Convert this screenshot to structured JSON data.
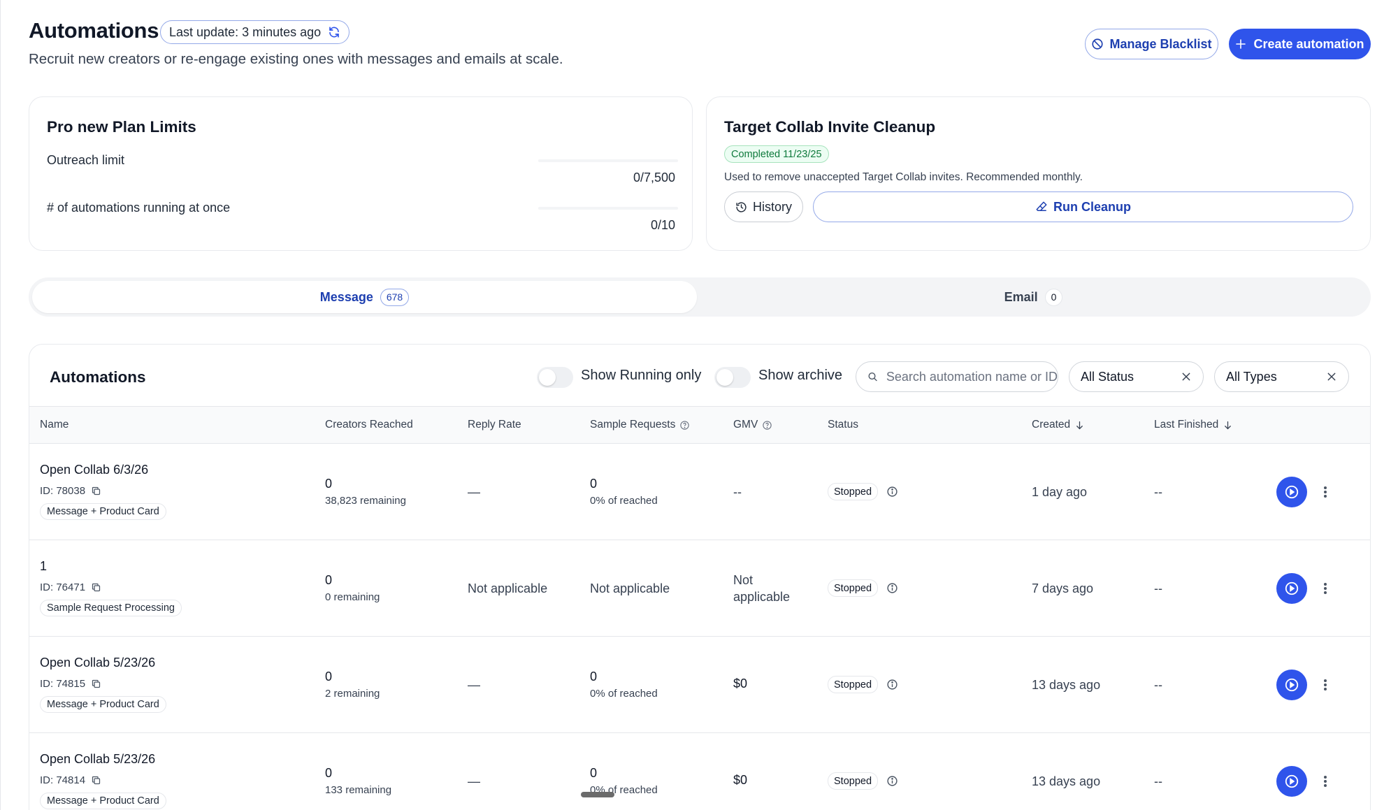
{
  "header": {
    "title": "Automations",
    "last_update": "Last update: 3 minutes ago",
    "subtitle": "Recruit new creators or re-engage existing ones with messages and emails at scale.",
    "manage_blacklist": "Manage Blacklist",
    "create_automation": "Create automation"
  },
  "limits_card": {
    "title": "Pro new Plan Limits",
    "outreach_label": "Outreach limit",
    "outreach_value": "0/7,500",
    "outreach_progress": 0,
    "running_label": "# of automations running at once",
    "running_value": "0/10",
    "running_progress": 0
  },
  "cleanup_card": {
    "title": "Target Collab Invite Cleanup",
    "badge": "Completed 11/23/25",
    "description": "Used to remove unaccepted Target Collab invites. Recommended monthly.",
    "history": "History",
    "run_cleanup": "Run Cleanup"
  },
  "tabs": [
    {
      "label": "Message",
      "count": "678",
      "active": true
    },
    {
      "label": "Email",
      "count": "0",
      "active": false
    }
  ],
  "table_panel": {
    "title": "Automations",
    "show_running": "Show Running only",
    "show_archive": "Show archive",
    "search_placeholder": "Search automation name or ID",
    "status_filter": "All Status",
    "type_filter": "All Types"
  },
  "columns": {
    "name": "Name",
    "creators": "Creators Reached",
    "reply": "Reply Rate",
    "samples": "Sample Requests",
    "gmv": "GMV",
    "status": "Status",
    "created": "Created",
    "last_finished": "Last Finished"
  },
  "rows": [
    {
      "name": "Open Collab 6/3/26",
      "id": "ID: 78038",
      "type": "Message + Product Card",
      "creators": "0",
      "remaining": "38,823 remaining",
      "reply": "—",
      "samples": "0",
      "samples_sub": "0% of reached",
      "gmv": "--",
      "status": "Stopped",
      "created": "1 day ago",
      "last_finished": "--"
    },
    {
      "name": "1",
      "id": "ID: 76471",
      "type": "Sample Request Processing",
      "creators": "0",
      "remaining": "0 remaining",
      "reply": "Not applicable",
      "samples": "Not applicable",
      "samples_sub": "",
      "gmv_line1": "Not",
      "gmv_line2": "applicable",
      "status": "Stopped",
      "created": "7 days ago",
      "last_finished": "--"
    },
    {
      "name": "Open Collab 5/23/26",
      "id": "ID: 74815",
      "type": "Message + Product Card",
      "creators": "0",
      "remaining": "2 remaining",
      "reply": "—",
      "samples": "0",
      "samples_sub": "0% of reached",
      "gmv": "$0",
      "status": "Stopped",
      "created": "13 days ago",
      "last_finished": "--"
    },
    {
      "name": "Open Collab 5/23/26",
      "id": "ID: 74814",
      "type": "Message + Product Card",
      "creators": "0",
      "remaining": "133 remaining",
      "reply": "—",
      "samples": "0",
      "samples_sub": "0% of reached",
      "gmv": "$0",
      "status": "Stopped",
      "created": "13 days ago",
      "last_finished": "--"
    }
  ],
  "colors": {
    "accent": "#2f54eb",
    "accent_text": "#1d3fb0",
    "success_bg": "#ecfdf3",
    "success_text": "#0f7a3d"
  }
}
